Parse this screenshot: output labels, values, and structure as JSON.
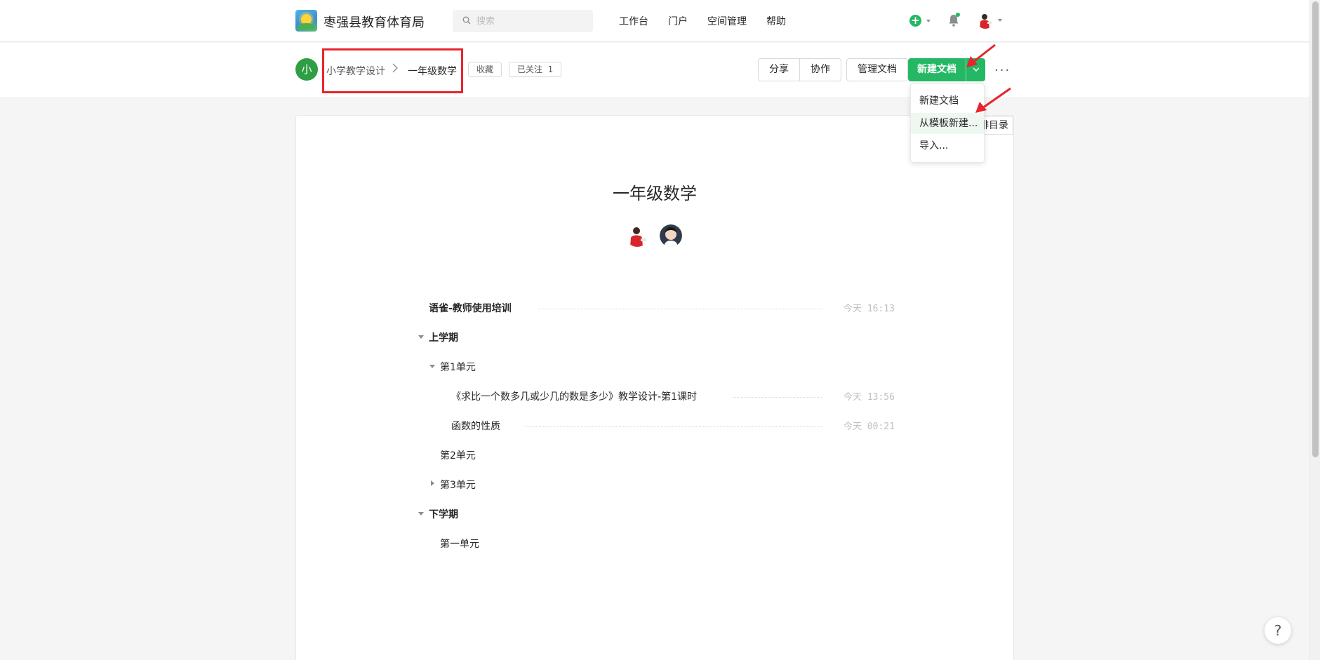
{
  "header": {
    "org_name": "枣强县教育体育局",
    "search_placeholder": "搜索",
    "nav": [
      "工作台",
      "门户",
      "空间管理",
      "帮助"
    ],
    "accent_color": "#25b864"
  },
  "breadcrumb": {
    "space_avatar_char": "小",
    "space": "小学教学设计",
    "book": "一年级数学"
  },
  "book_actions": {
    "favorite": "收藏",
    "followed": "已关注",
    "follow_count": "1"
  },
  "toolbar": {
    "share": "分享",
    "collaborate": "协作",
    "manage": "管理文档",
    "new_doc": "新建文档"
  },
  "dropdown": {
    "items": [
      "新建文档",
      "从模板新建...",
      "导入..."
    ]
  },
  "toc_button": "排目录",
  "book_title": "一年级数学",
  "toc": [
    {
      "title": "语雀-教师使用培训",
      "time": "今天 16:13"
    },
    {
      "title": "上学期"
    },
    {
      "title": "第1单元"
    },
    {
      "title": "《求比一个数多几或少几的数是多少》教学设计-第1课时",
      "time": "今天 13:56"
    },
    {
      "title": "函数的性质",
      "time": "今天 00:21"
    },
    {
      "title": "第2单元"
    },
    {
      "title": "第3单元"
    },
    {
      "title": "下学期"
    },
    {
      "title": "第一单元"
    }
  ],
  "help": "?"
}
